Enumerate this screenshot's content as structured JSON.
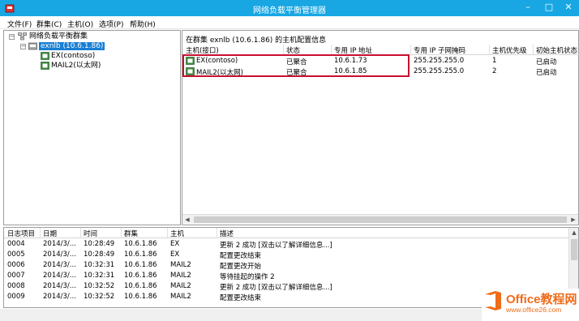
{
  "window": {
    "title": "网络负载平衡管理器"
  },
  "menu": [
    "文件(F)",
    "群集(C)",
    "主机(O)",
    "选项(P)",
    "帮助(H)"
  ],
  "tree": {
    "root": "网络负载平衡群集",
    "cluster": "exnlb (10.6.1.86)",
    "hosts": [
      "EX(contoso)",
      "MAIL2(以太网)"
    ]
  },
  "hosts_panel": {
    "heading": "在群集 exnlb (10.6.1.86) 的主机配置信息",
    "columns": [
      "主机(接口)",
      "状态",
      "专用 IP 地址",
      "专用 IP 子网掩码",
      "主机优先级",
      "初始主机状态"
    ],
    "rows": [
      [
        "EX(contoso)",
        "已聚合",
        "10.6.1.73",
        "255.255.255.0",
        "1",
        "已启动"
      ],
      [
        "MAIL2(以太网)",
        "已聚合",
        "10.6.1.85",
        "255.255.255.0",
        "2",
        "已启动"
      ]
    ]
  },
  "log": {
    "columns": [
      "日志项目",
      "日期",
      "时间",
      "群集",
      "主机",
      "描述"
    ],
    "rows": [
      [
        "0004",
        "2014/3/...",
        "10:28:49",
        "10.6.1.86",
        "EX",
        "更新 2 成功 [双击以了解详细信息...]"
      ],
      [
        "0005",
        "2014/3/...",
        "10:28:49",
        "10.6.1.86",
        "EX",
        "配置更改结束"
      ],
      [
        "0006",
        "2014/3/...",
        "10:32:31",
        "10.6.1.86",
        "MAIL2",
        "配置更改开始"
      ],
      [
        "0007",
        "2014/3/...",
        "10:32:31",
        "10.6.1.86",
        "MAIL2",
        "等待挂起的操作 2"
      ],
      [
        "0008",
        "2014/3/...",
        "10:32:52",
        "10.6.1.86",
        "MAIL2",
        "更新 2 成功 [双击以了解详细信息...]"
      ],
      [
        "0009",
        "2014/3/...",
        "10:32:52",
        "10.6.1.86",
        "MAIL2",
        "配置更改结束"
      ]
    ]
  },
  "watermark": {
    "name": "Office教程网",
    "url": "www.office26.com"
  },
  "colors": {
    "titlebar": "#18a7e3",
    "selection": "#1a7fd4",
    "highlight_box": "#c8102e",
    "watermark": "#ef6c1a"
  },
  "icons": [
    "app-icon",
    "minimize-icon",
    "maximize-icon",
    "close-icon",
    "cluster-tree-icon",
    "cluster-icon",
    "host-icon"
  ]
}
